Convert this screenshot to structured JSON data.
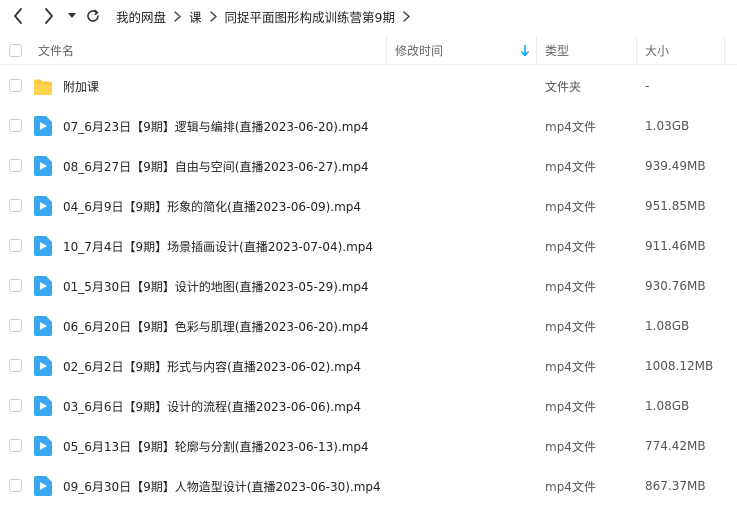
{
  "nav": {
    "breadcrumb": [
      "我的网盘",
      "课",
      "同捉平面图形构成训练营第9期"
    ]
  },
  "columns": {
    "name": "文件名",
    "modified": "修改时间",
    "type": "类型",
    "size": "大小"
  },
  "files": [
    {
      "icon": "folder-icon",
      "name": "附加课",
      "type": "文件夹",
      "size": "-"
    },
    {
      "icon": "video-file-icon",
      "name": "07_6月23日【9期】逻辑与编排(直播2023-06-20).mp4",
      "type": "mp4文件",
      "size": "1.03GB"
    },
    {
      "icon": "video-file-icon",
      "name": "08_6月27日【9期】自由与空间(直播2023-06-27).mp4",
      "type": "mp4文件",
      "size": "939.49MB"
    },
    {
      "icon": "video-file-icon",
      "name": "04_6月9日【9期】形象的简化(直播2023-06-09).mp4",
      "type": "mp4文件",
      "size": "951.85MB"
    },
    {
      "icon": "video-file-icon",
      "name": "10_7月4日【9期】场景插画设计(直播2023-07-04).mp4",
      "type": "mp4文件",
      "size": "911.46MB"
    },
    {
      "icon": "video-file-icon",
      "name": "01_5月30日【9期】设计的地图(直播2023-05-29).mp4",
      "type": "mp4文件",
      "size": "930.76MB"
    },
    {
      "icon": "video-file-icon",
      "name": "06_6月20日【9期】色彩与肌理(直播2023-06-20).mp4",
      "type": "mp4文件",
      "size": "1.08GB"
    },
    {
      "icon": "video-file-icon",
      "name": "02_6月2日【9期】形式与内容(直播2023-06-02).mp4",
      "type": "mp4文件",
      "size": "1008.12MB"
    },
    {
      "icon": "video-file-icon",
      "name": "03_6月6日【9期】设计的流程(直播2023-06-06).mp4",
      "type": "mp4文件",
      "size": "1.08GB"
    },
    {
      "icon": "video-file-icon",
      "name": "05_6月13日【9期】轮廓与分割(直播2023-06-13).mp4",
      "type": "mp4文件",
      "size": "774.42MB"
    },
    {
      "icon": "video-file-icon",
      "name": "09_6月30日【9期】人物造型设计(直播2023-06-30).mp4",
      "type": "mp4文件",
      "size": "867.37MB"
    }
  ],
  "colors": {
    "accent": "#06a7ff",
    "folder": "#ffc93d"
  }
}
